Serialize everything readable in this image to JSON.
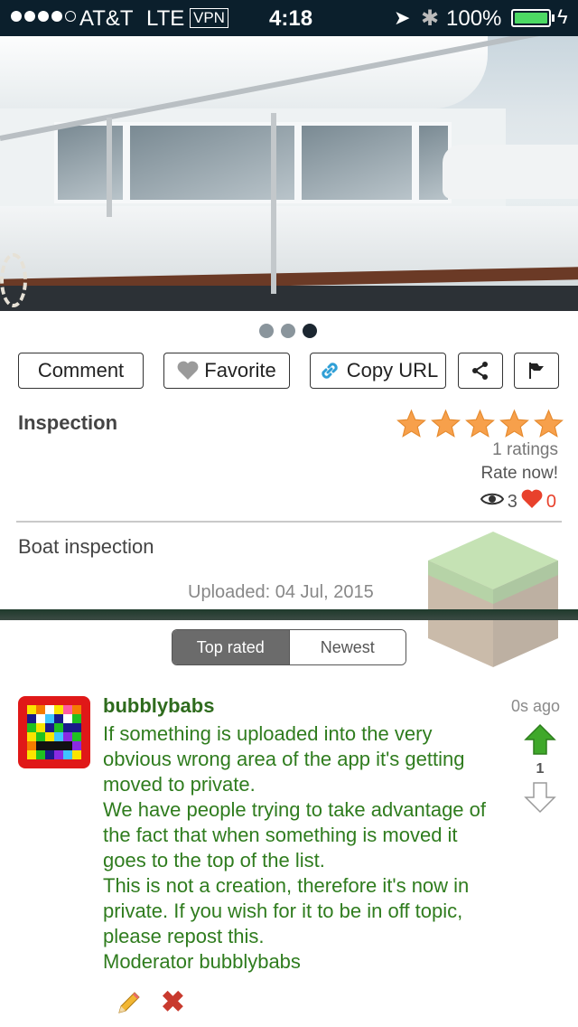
{
  "status_bar": {
    "carrier": "AT&T",
    "network": "LTE",
    "vpn": "VPN",
    "time": "4:18",
    "battery": "100%"
  },
  "gallery": {
    "pages": 3,
    "current_page": 3
  },
  "actions": {
    "comment": "Comment",
    "favorite": "Favorite",
    "copy_url": "Copy URL",
    "share_icon": "share-icon",
    "report_icon": "flag-icon"
  },
  "item": {
    "title": "Inspection",
    "rating_stars": 5,
    "ratings_text": "1 ratings",
    "rate_now": "Rate now!",
    "views": "3",
    "likes": "0",
    "description": "Boat inspection",
    "uploaded": "Uploaded: 04 Jul, 2015"
  },
  "sort": {
    "top_rated": "Top rated",
    "newest": "Newest",
    "selected": "Top rated"
  },
  "comment": {
    "author": "bubblybabs",
    "time": "0s ago",
    "body": "If something is uploaded into the very obvious wrong area of the app it's getting moved to private.\nWe have people trying to take advantage of the fact that when something is moved it goes to the top of the list.\nThis is not a creation, therefore it's now in private. If you wish for it to be in off topic, please repost this.\nModerator bubblybabs",
    "votes": "1"
  },
  "colors": {
    "status_bar": "#0b1f2c",
    "star": "#f7a04b",
    "comment_text": "#2f7c1e",
    "upvote": "#3fa82a",
    "like_heart": "#e8412c"
  }
}
